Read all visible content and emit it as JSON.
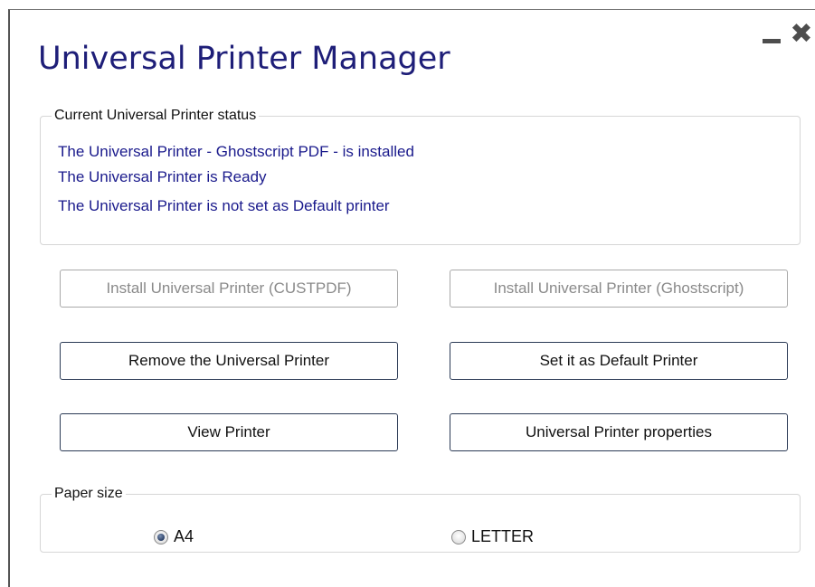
{
  "window": {
    "title": "Universal Printer Manager",
    "minimize_icon": "minimize-icon",
    "close_icon": "close-icon",
    "close_glyph": "✖"
  },
  "status": {
    "legend": "Current Universal Printer status",
    "lines": [
      "The Universal Printer - Ghostscript PDF - is installed",
      "The Universal Printer is Ready",
      "The Universal Printer is not set as Default printer"
    ],
    "text_color": "#1a1a8c"
  },
  "buttons": {
    "install_custpdf": {
      "label": "Install Universal Printer (CUSTPDF)",
      "enabled": false
    },
    "install_ghostscript": {
      "label": "Install Universal Printer (Ghostscript)",
      "enabled": false
    },
    "remove": {
      "label": "Remove the Universal Printer",
      "enabled": true
    },
    "set_default": {
      "label": "Set it as Default Printer",
      "enabled": true
    },
    "view": {
      "label": "View Printer",
      "enabled": true
    },
    "properties": {
      "label": "Universal Printer properties",
      "enabled": true
    }
  },
  "paper_size": {
    "legend": "Paper size",
    "options": [
      {
        "label": "A4",
        "checked": true
      },
      {
        "label": "LETTER",
        "checked": false
      }
    ]
  },
  "colors": {
    "title": "#1e1e78",
    "button_border": "#2b3a55",
    "disabled_text": "#8a8a8a"
  }
}
